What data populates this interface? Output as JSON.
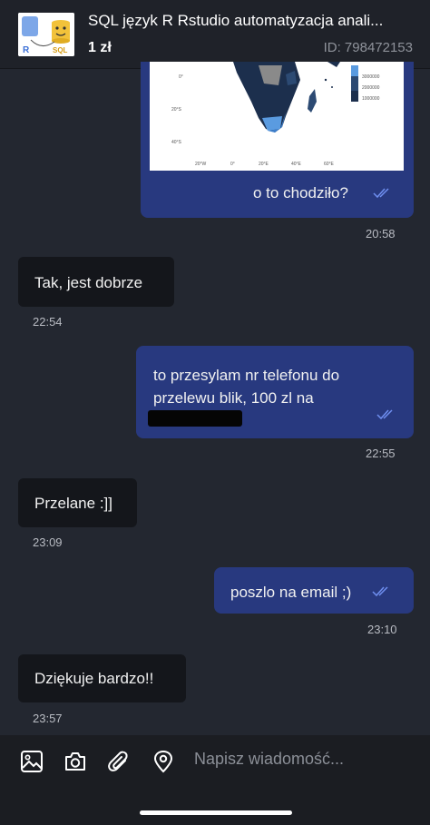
{
  "header": {
    "title": "SQL język R Rstudio automatyzacja anali...",
    "price": "1 zł",
    "listing_id": "ID: 798472153",
    "thumb_text_left": "R",
    "thumb_text_right": "SQL"
  },
  "map": {
    "lat_labels": [
      "0°",
      "20°S",
      "40°S"
    ],
    "lon_labels": [
      "20°W",
      "0°",
      "20°E",
      "40°E",
      "60°E"
    ],
    "legend_values": [
      "3000000",
      "2000000",
      "1000000"
    ]
  },
  "messages": [
    {
      "direction": "out",
      "text": "o to chodziło?",
      "time": "20:58",
      "read": true
    },
    {
      "direction": "in",
      "text": "Tak, jest dobrze",
      "time": "22:54"
    },
    {
      "direction": "out",
      "line1": "to przesylam nr telefonu do",
      "line2": "przelewu blik, 100 zl na",
      "time": "22:55",
      "read": true
    },
    {
      "direction": "in",
      "text": "Przelane :]]",
      "time": "23:09"
    },
    {
      "direction": "out",
      "text": "poszlo na email ;)",
      "time": "23:10",
      "read": true
    },
    {
      "direction": "in",
      "text": "Dziękuje bardzo!!",
      "time": "23:57"
    }
  ],
  "composer": {
    "placeholder": "Napisz wiadomość...",
    "icons": [
      "image-icon",
      "camera-icon",
      "paperclip-icon",
      "location-icon"
    ]
  },
  "colors": {
    "background": "#232730",
    "outgoing_bubble": "#28397f",
    "incoming_bubble": "#14161b",
    "read_check": "#6f8ff0"
  }
}
